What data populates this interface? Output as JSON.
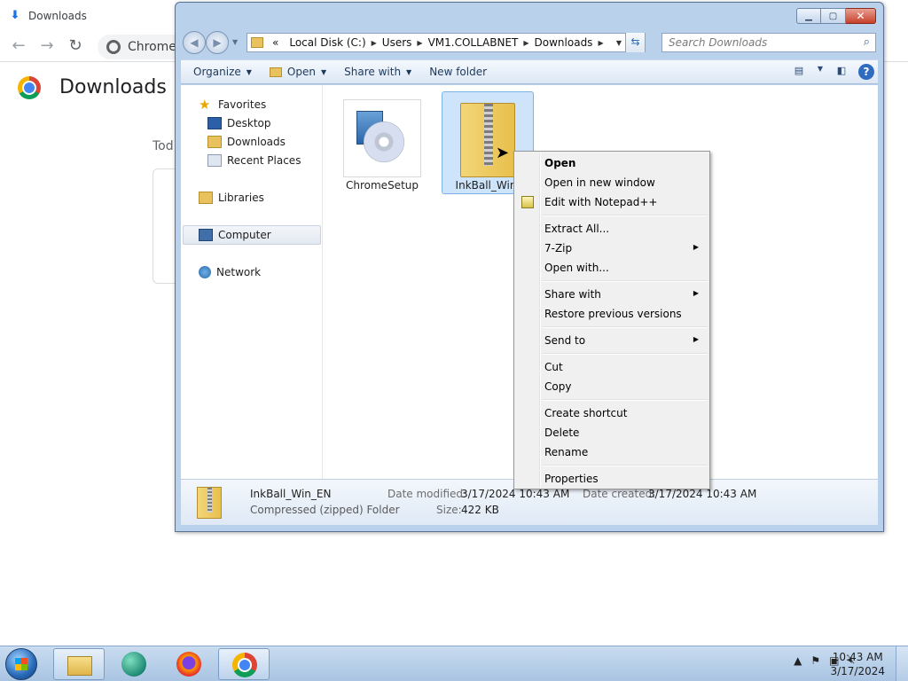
{
  "chrome": {
    "tab_title": "Downloads",
    "omnibox_text": "Chrome",
    "page_title": "Downloads",
    "today_label": "Tod"
  },
  "explorer": {
    "address": {
      "overflow": "«",
      "segments": [
        "Local Disk (C:)",
        "Users",
        "VM1.COLLABNET",
        "Downloads"
      ]
    },
    "search_placeholder": "Search Downloads",
    "commands": {
      "organize": "Organize",
      "open": "Open",
      "share_with": "Share with",
      "new_folder": "New folder"
    },
    "nav": {
      "favorites": "Favorites",
      "desktop": "Desktop",
      "downloads": "Downloads",
      "recent_places": "Recent Places",
      "libraries": "Libraries",
      "computer": "Computer",
      "network": "Network"
    },
    "files": [
      {
        "name": "ChromeSetup"
      },
      {
        "name": "InkBall_Win_"
      }
    ],
    "details": {
      "name": "InkBall_Win_EN",
      "type": "Compressed (zipped) Folder",
      "date_modified_label": "Date modified:",
      "date_modified": "3/17/2024 10:43 AM",
      "date_created_label": "Date created:",
      "date_created": "3/17/2024 10:43 AM",
      "size_label": "Size:",
      "size": "422 KB"
    }
  },
  "context_menu": {
    "open": "Open",
    "open_new_window": "Open in new window",
    "edit_notepad": "Edit with Notepad++",
    "extract_all": "Extract All...",
    "seven_zip": "7-Zip",
    "open_with": "Open with...",
    "share_with": "Share with",
    "restore_versions": "Restore previous versions",
    "send_to": "Send to",
    "cut": "Cut",
    "copy": "Copy",
    "create_shortcut": "Create shortcut",
    "delete": "Delete",
    "rename": "Rename",
    "properties": "Properties"
  },
  "taskbar": {
    "time": "10:43 AM",
    "date": "3/17/2024"
  }
}
